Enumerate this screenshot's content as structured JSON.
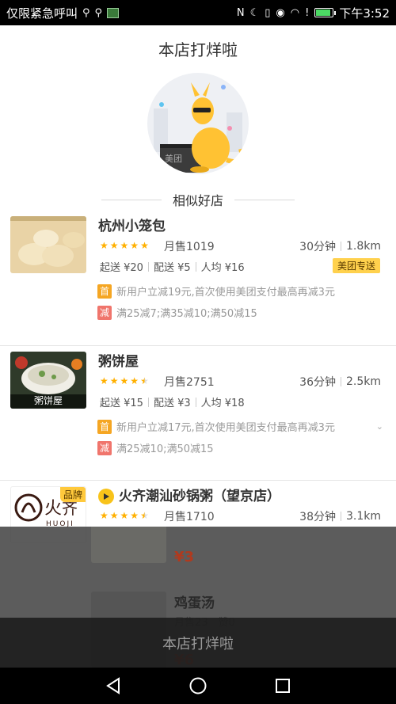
{
  "status_bar": {
    "left_text": "仅限紧急呼叫",
    "time": "下午3:52"
  },
  "header": {
    "title": "本店打烊啦"
  },
  "section": {
    "title": "相似好店"
  },
  "stores": [
    {
      "name": "杭州小笼包",
      "rating": 5,
      "sales": "月售1019",
      "time": "30分钟",
      "distance": "1.8km",
      "min_order": "起送 ¥20",
      "delivery_fee": "配送 ¥5",
      "avg_price": "人均 ¥16",
      "badge": "美团专送",
      "promo_first_tag": "首",
      "promo_first": "新用户立减19元,首次使用美团支付最高再减3元",
      "promo_reduce_tag": "减",
      "promo_reduce": "满25减7;满35减10;满50减15"
    },
    {
      "name": "粥饼屋",
      "rating": 4.5,
      "sales": "月售2751",
      "time": "36分钟",
      "distance": "2.5km",
      "min_order": "起送 ¥15",
      "delivery_fee": "配送 ¥3",
      "avg_price": "人均 ¥18",
      "thumb_label": "粥饼屋",
      "promo_first_tag": "首",
      "promo_first": "新用户立减17元,首次使用美团支付最高再减3元",
      "promo_reduce_tag": "减",
      "promo_reduce": "满25减10;满50减15"
    },
    {
      "name": "火齐潮汕砂锅粥（望京店）",
      "rating": 4.5,
      "sales": "月售1710",
      "time": "38分钟",
      "distance": "3.1km",
      "brand_badge": "品牌",
      "logo_text": "HUOJI"
    }
  ],
  "background_menu": {
    "price1": "¥3",
    "item2_name": "鸡蛋汤",
    "item2_faint": "月售23　赞0",
    "price2": "¥6"
  },
  "bottom_banner": {
    "text": "本店打烊啦"
  },
  "colors": {
    "star": "#ffb000",
    "badge_yellow": "#ffd14d",
    "promo_first": "#f5a623",
    "promo_reduce": "#f0756c"
  }
}
